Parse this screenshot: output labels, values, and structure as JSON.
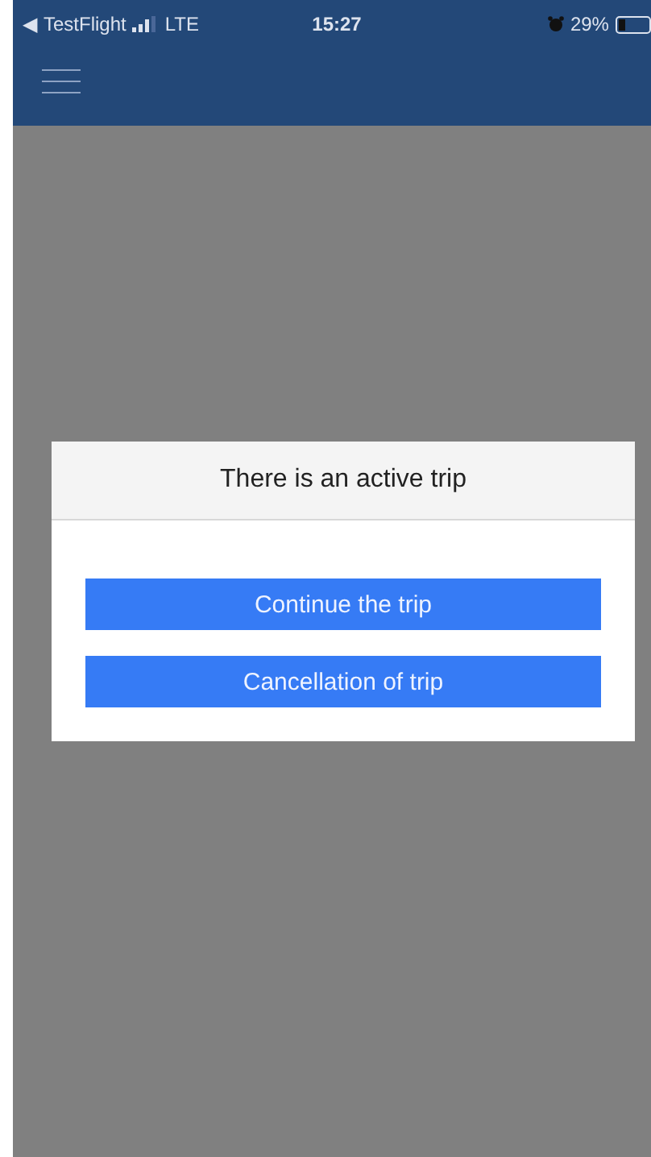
{
  "status_bar": {
    "back_arrow": "◀",
    "back_app": "TestFlight",
    "network": "LTE",
    "time": "15:27",
    "battery": "29%"
  },
  "dialog": {
    "title": "There is an active trip",
    "buttons": [
      "Continue the trip",
      "Cancellation of trip"
    ]
  }
}
